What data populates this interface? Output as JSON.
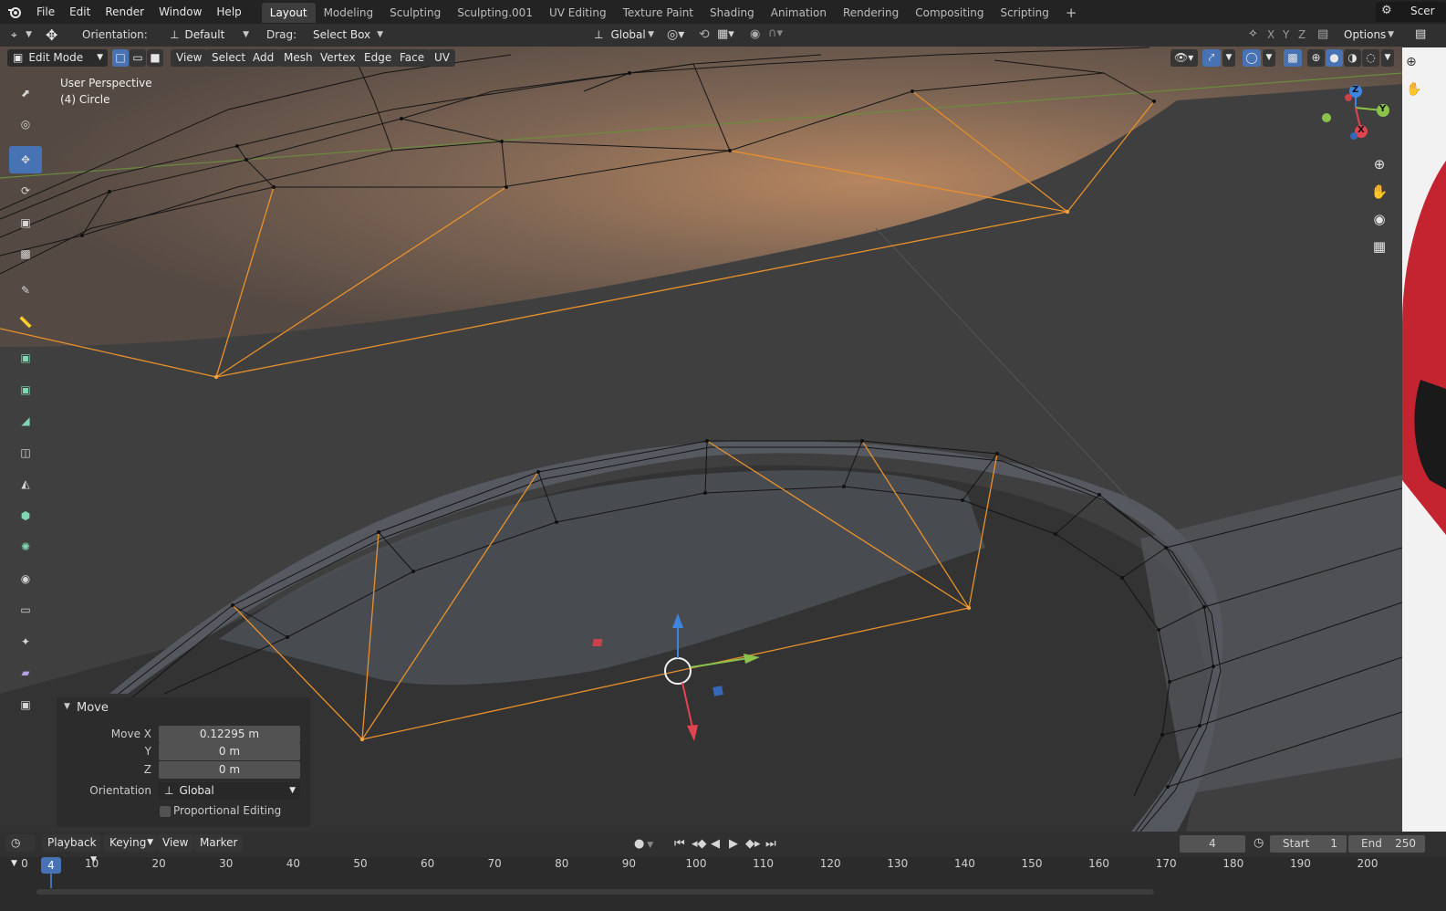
{
  "menu": {
    "items": [
      "File",
      "Edit",
      "Render",
      "Window",
      "Help"
    ]
  },
  "workspaces": {
    "tabs": [
      "Layout",
      "Modeling",
      "Sculpting",
      "Sculpting.001",
      "UV Editing",
      "Texture Paint",
      "Shading",
      "Animation",
      "Rendering",
      "Compositing",
      "Scripting"
    ],
    "active": "Layout",
    "add_label": "+"
  },
  "scene": {
    "label": "Scer"
  },
  "tool_header": {
    "orientation_label": "Orientation:",
    "orientation_value": "Default",
    "drag_label": "Drag:",
    "drag_value": "Select Box",
    "transform_orientation": "Global",
    "axis_x": "X",
    "axis_y": "Y",
    "axis_z": "Z",
    "options": "Options"
  },
  "viewport_header": {
    "mode": "Edit Mode",
    "menus": [
      "View",
      "Select",
      "Add",
      "Mesh",
      "Vertex",
      "Edge",
      "Face",
      "UV"
    ]
  },
  "viewport": {
    "perspective": "User Perspective",
    "object": "(4) Circle",
    "gizmo": {
      "x": "X",
      "y": "Y",
      "z": "Z"
    }
  },
  "move_panel": {
    "title": "Move",
    "move_x_label": "Move X",
    "move_x": "0.12295 m",
    "y_label": "Y",
    "y": "0 m",
    "z_label": "Z",
    "z": "0 m",
    "orientation_label": "Orientation",
    "orientation": "Global",
    "proportional": "Proportional Editing"
  },
  "timeline": {
    "menus": [
      "Playback",
      "Keying",
      "View",
      "Marker"
    ],
    "current_frame": "4",
    "start_label": "Start",
    "start": "1",
    "end_label": "End",
    "end": "250",
    "ticks": [
      "0",
      "10",
      "20",
      "30",
      "40",
      "50",
      "60",
      "70",
      "80",
      "90",
      "100",
      "110",
      "120",
      "130",
      "140",
      "150",
      "160",
      "170",
      "180",
      "190",
      "200"
    ],
    "playhead": "4"
  },
  "colors": {
    "accent": "#4772b3",
    "selected_edge": "#e8912c",
    "x_axis": "#e0454f",
    "y_axis": "#8bc34a",
    "z_axis": "#3f85e0"
  }
}
